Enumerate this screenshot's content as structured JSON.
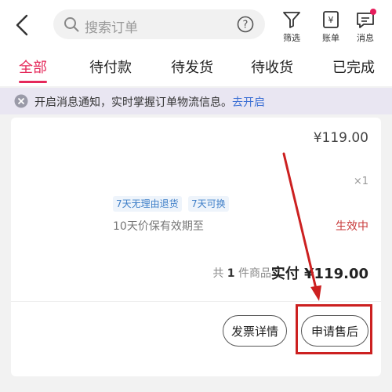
{
  "header": {
    "search_placeholder": "搜索订单",
    "tools": [
      {
        "label": "筛选",
        "icon": "filter-icon"
      },
      {
        "label": "账单",
        "icon": "bill-icon"
      },
      {
        "label": "消息",
        "icon": "message-icon"
      }
    ]
  },
  "tabs": [
    "全部",
    "待付款",
    "待发货",
    "待收货",
    "已完成"
  ],
  "active_tab": "全部",
  "notice": {
    "message": "开启消息通知，实时掌握订单物流信息。",
    "link": "去开启"
  },
  "order": {
    "unit_price": "¥119.00",
    "quantity": "×1",
    "tags": [
      "7天无理由退货",
      "7天可换"
    ],
    "validity_text": "10天价保有效期至",
    "validity_status": "生效中",
    "count_prefix": "共",
    "count_value": "1",
    "count_suffix": "件商品",
    "paid_label": "实付",
    "paid_amount": "¥119.00",
    "buttons": {
      "invoice": "发票详情",
      "after_sale": "申请售后"
    }
  },
  "colors": {
    "accent": "#e5285a",
    "link": "#3b6fd4",
    "annotation": "#cc2020"
  }
}
